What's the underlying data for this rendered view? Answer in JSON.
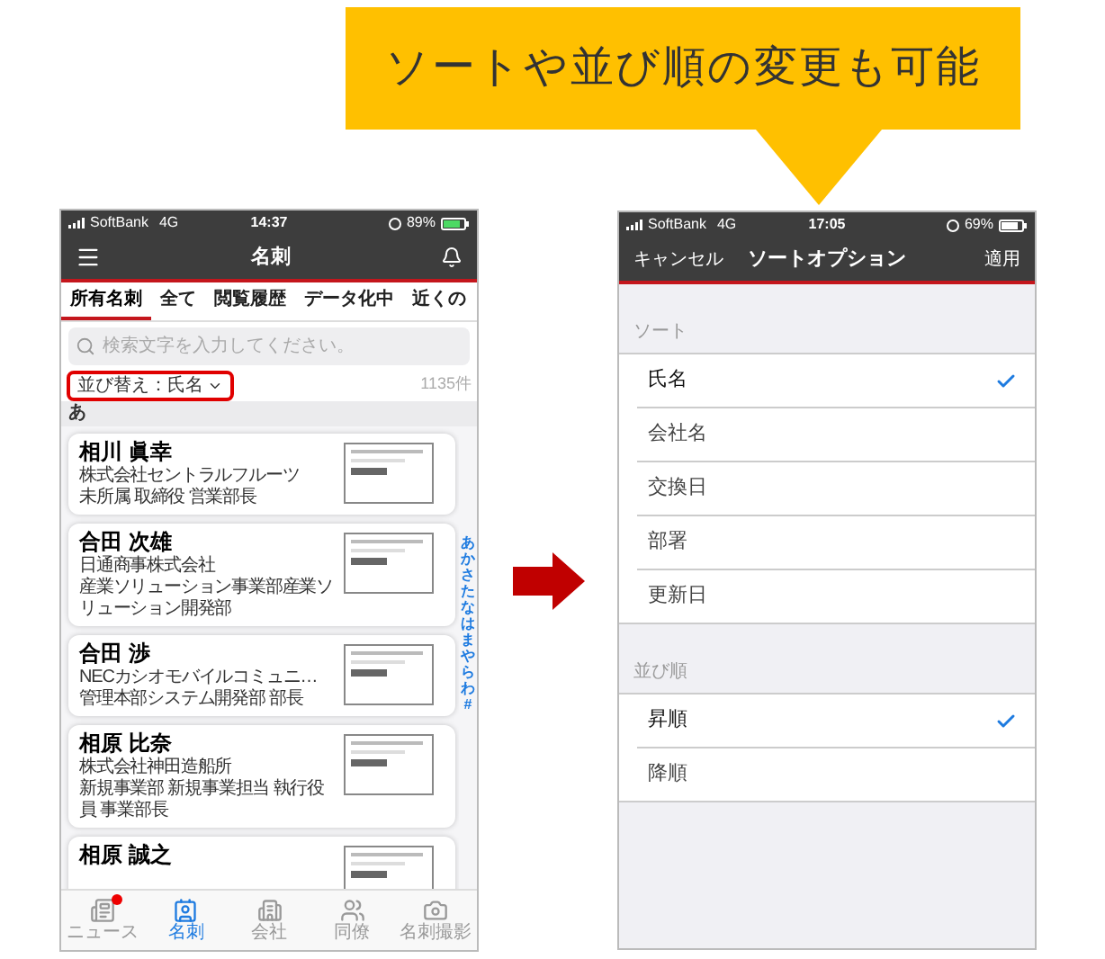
{
  "callout": {
    "text": "ソートや並び順の変更も可能"
  },
  "left_screen": {
    "status_bar": {
      "carrier": "SoftBank",
      "network": "4G",
      "time": "14:37",
      "battery": "89%",
      "charging": true
    },
    "nav_bar": {
      "title": "名刺"
    },
    "tabs": [
      {
        "label": "所有名刺",
        "selected": true
      },
      {
        "label": "全て",
        "selected": false
      },
      {
        "label": "閲覧履歴",
        "selected": false
      },
      {
        "label": "データ化中",
        "selected": false
      },
      {
        "label": "近くの",
        "selected": false
      }
    ],
    "search": {
      "placeholder": "検索文字を入力してください。"
    },
    "sort": {
      "label": "並び替え：氏名",
      "highlighted": true
    },
    "count": "1135件",
    "section_header": "あ",
    "cards": [
      {
        "name": "相川 眞幸",
        "lines": [
          "株式会社セントラルフルーツ",
          "未所属 取締役 営業部長"
        ]
      },
      {
        "name": "合田 次雄",
        "lines": [
          "日通商事株式会社",
          "産業ソリューション事業部産業ソリューション開発部"
        ]
      },
      {
        "name": "合田 渉",
        "lines": [
          "NECカシオモバイルコミュニ…",
          "管理本部システム開発部 部長"
        ]
      },
      {
        "name": "相原 比奈",
        "lines": [
          "株式会社神田造船所",
          "新規事業部 新規事業担当 執行役員 事業部長"
        ]
      },
      {
        "name": "相原 誠之"
      }
    ],
    "index": [
      "あ",
      "か",
      "さ",
      "た",
      "な",
      "は",
      "ま",
      "や",
      "ら",
      "わ",
      "#"
    ],
    "tab_bar": [
      {
        "kind": "news",
        "label": "ニュース",
        "selected": false,
        "badge": true
      },
      {
        "kind": "cards",
        "label": "名刺",
        "selected": true,
        "badge": false
      },
      {
        "kind": "company",
        "label": "会社",
        "selected": false,
        "badge": false
      },
      {
        "kind": "colleagues",
        "label": "同僚",
        "selected": false,
        "badge": false
      },
      {
        "kind": "camera",
        "label": "名刺撮影",
        "selected": false,
        "badge": false
      }
    ]
  },
  "right_screen": {
    "status_bar": {
      "carrier": "SoftBank",
      "network": "4G",
      "time": "17:05",
      "battery": "69%",
      "charging": false
    },
    "nav_bar": {
      "cancel": "キャンセル",
      "title": "ソートオプション",
      "apply": "適用"
    },
    "sections": [
      {
        "header": "ソート",
        "options": [
          {
            "label": "氏名",
            "selected": true
          },
          {
            "label": "会社名",
            "selected": false
          },
          {
            "label": "交換日",
            "selected": false
          },
          {
            "label": "部署",
            "selected": false
          },
          {
            "label": "更新日",
            "selected": false
          }
        ]
      },
      {
        "header": "並び順",
        "options": [
          {
            "label": "昇順",
            "selected": true
          },
          {
            "label": "降順",
            "selected": false
          }
        ]
      }
    ]
  }
}
